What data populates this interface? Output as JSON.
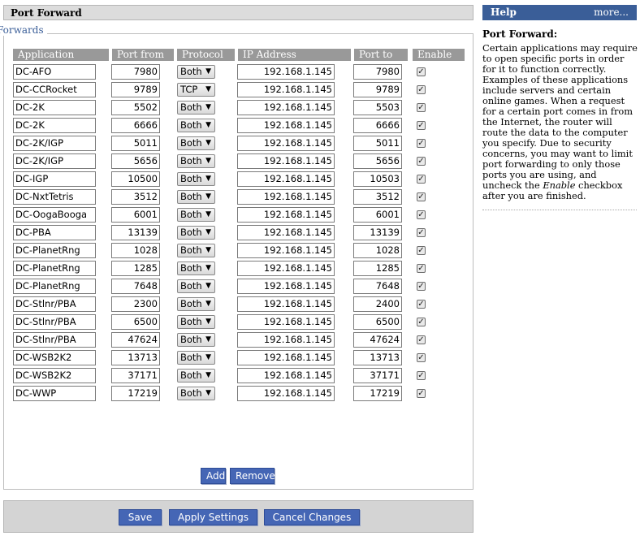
{
  "header": {
    "title": "Port Forward"
  },
  "help": {
    "title": "Help",
    "more": "more...",
    "heading": "Port Forward:",
    "body_before": "Certain applications may require to open specific ports in order for it to function correctly. Examples of these applications include servers and certain online games. When a request for a certain port comes in from the Internet, the router will route the data to the computer you specify. Due to security concerns, you may want to limit port forwarding to only those ports you are using, and uncheck the ",
    "body_em": "Enable",
    "body_after": " checkbox after you are finished."
  },
  "forwards": {
    "legend": "Forwards",
    "columns": [
      "Application",
      "Port from",
      "Protocol",
      "IP Address",
      "Port to",
      "Enable"
    ],
    "rows": [
      {
        "app": "DC-AFO",
        "from": "7980",
        "protocol": "Both",
        "ip": "192.168.1.145",
        "to": "7980",
        "enabled": true
      },
      {
        "app": "DC-CCRocket",
        "from": "9789",
        "protocol": "TCP",
        "ip": "192.168.1.145",
        "to": "9789",
        "enabled": true
      },
      {
        "app": "DC-2K",
        "from": "5502",
        "protocol": "Both",
        "ip": "192.168.1.145",
        "to": "5503",
        "enabled": true
      },
      {
        "app": "DC-2K",
        "from": "6666",
        "protocol": "Both",
        "ip": "192.168.1.145",
        "to": "6666",
        "enabled": true
      },
      {
        "app": "DC-2K/IGP",
        "from": "5011",
        "protocol": "Both",
        "ip": "192.168.1.145",
        "to": "5011",
        "enabled": true
      },
      {
        "app": "DC-2K/IGP",
        "from": "5656",
        "protocol": "Both",
        "ip": "192.168.1.145",
        "to": "5656",
        "enabled": true
      },
      {
        "app": "DC-IGP",
        "from": "10500",
        "protocol": "Both",
        "ip": "192.168.1.145",
        "to": "10503",
        "enabled": true
      },
      {
        "app": "DC-NxtTetris",
        "from": "3512",
        "protocol": "Both",
        "ip": "192.168.1.145",
        "to": "3512",
        "enabled": true
      },
      {
        "app": "DC-OogaBooga",
        "from": "6001",
        "protocol": "Both",
        "ip": "192.168.1.145",
        "to": "6001",
        "enabled": true
      },
      {
        "app": "DC-PBA",
        "from": "13139",
        "protocol": "Both",
        "ip": "192.168.1.145",
        "to": "13139",
        "enabled": true
      },
      {
        "app": "DC-PlanetRng",
        "from": "1028",
        "protocol": "Both",
        "ip": "192.168.1.145",
        "to": "1028",
        "enabled": true
      },
      {
        "app": "DC-PlanetRng",
        "from": "1285",
        "protocol": "Both",
        "ip": "192.168.1.145",
        "to": "1285",
        "enabled": true
      },
      {
        "app": "DC-PlanetRng",
        "from": "7648",
        "protocol": "Both",
        "ip": "192.168.1.145",
        "to": "7648",
        "enabled": true
      },
      {
        "app": "DC-Stlnr/PBA",
        "from": "2300",
        "protocol": "Both",
        "ip": "192.168.1.145",
        "to": "2400",
        "enabled": true
      },
      {
        "app": "DC-Stlnr/PBA",
        "from": "6500",
        "protocol": "Both",
        "ip": "192.168.1.145",
        "to": "6500",
        "enabled": true
      },
      {
        "app": "DC-Stlnr/PBA",
        "from": "47624",
        "protocol": "Both",
        "ip": "192.168.1.145",
        "to": "47624",
        "enabled": true
      },
      {
        "app": "DC-WSB2K2",
        "from": "13713",
        "protocol": "Both",
        "ip": "192.168.1.145",
        "to": "13713",
        "enabled": true
      },
      {
        "app": "DC-WSB2K2",
        "from": "37171",
        "protocol": "Both",
        "ip": "192.168.1.145",
        "to": "37171",
        "enabled": true
      },
      {
        "app": "DC-WWP",
        "from": "17219",
        "protocol": "Both",
        "ip": "192.168.1.145",
        "to": "17219",
        "enabled": true
      }
    ],
    "add_label": "Add",
    "remove_label": "Remove"
  },
  "footer": {
    "save_label": "Save",
    "apply_label": "Apply Settings",
    "cancel_label": "Cancel Changes"
  },
  "icons": {
    "dropdown": "chevron-down-icon",
    "check": "checkmark-icon"
  },
  "colors": {
    "accent": "#3a5e98",
    "button": "#4566b5",
    "column_header": "#999999"
  }
}
